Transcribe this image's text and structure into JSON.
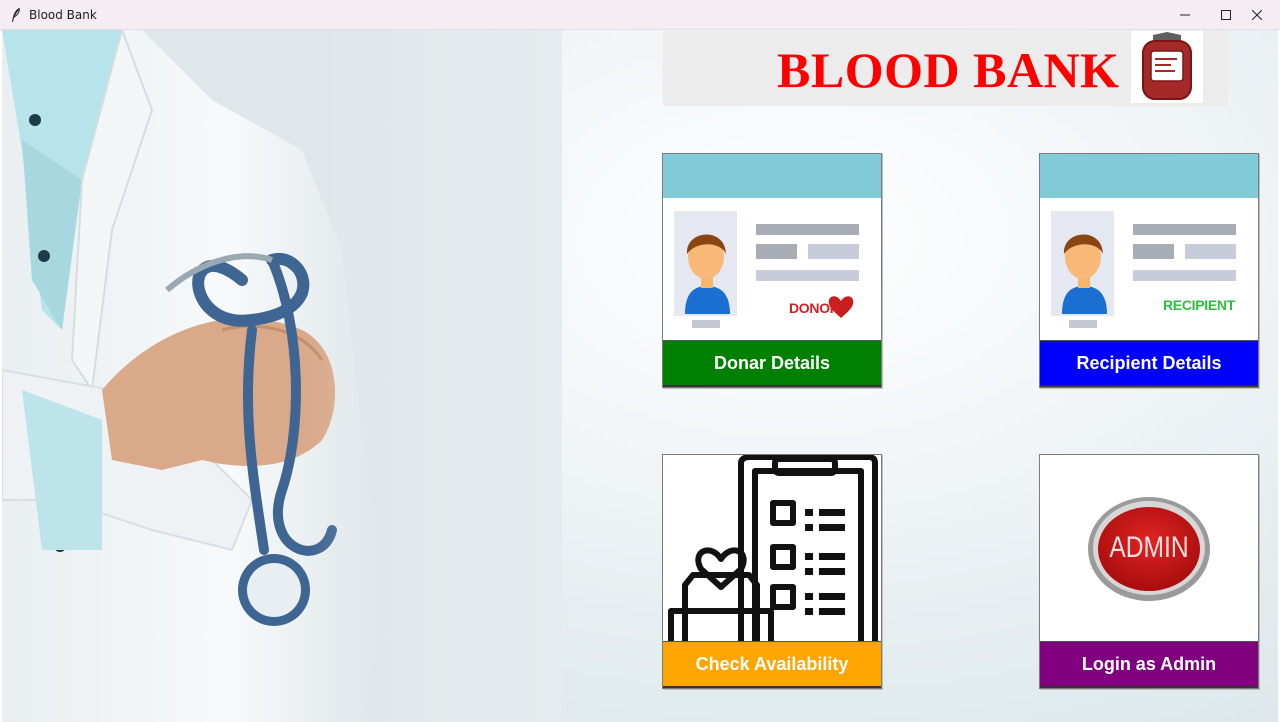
{
  "window": {
    "title": "Blood Bank",
    "controls": [
      "minimize-icon",
      "maximize-icon",
      "close-icon"
    ]
  },
  "header": {
    "title": "BLOOD BANK",
    "logo_icon": "blood-bag-icon",
    "title_color": "#ff0000"
  },
  "cards": [
    {
      "id": "donor",
      "label": "Donar Details",
      "color": "#008000",
      "badge": "DONOR",
      "icon": "donor-id-card-icon"
    },
    {
      "id": "recipient",
      "label": "Recipient Details",
      "color": "#0000ff",
      "badge": "RECIPIENT",
      "icon": "recipient-id-card-icon"
    },
    {
      "id": "availability",
      "label": "Check Availability",
      "color": "#ffa500",
      "icon": "checklist-heart-icon"
    },
    {
      "id": "admin",
      "label": "Login as Admin",
      "color": "#800080",
      "badge": "ADMIN",
      "icon": "admin-button-icon"
    }
  ]
}
